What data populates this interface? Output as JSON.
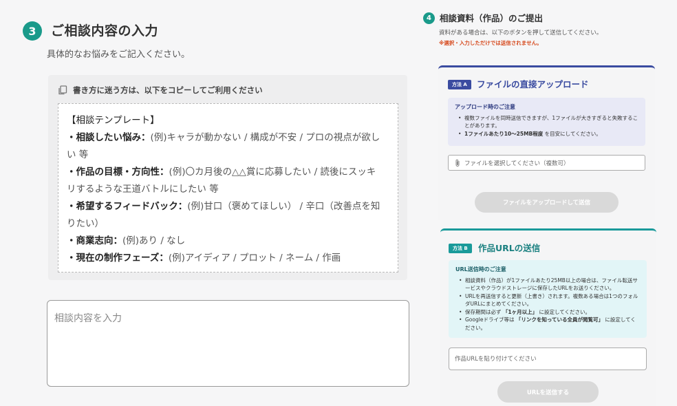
{
  "step3": {
    "number": "3",
    "title": "ご相談内容の入力",
    "description": "具体的なお悩みをご記入ください。",
    "template_header": "書き方に迷う方は、以下をコピーしてご利用ください",
    "template_heading": "【相談テンプレート】",
    "template_items": [
      {
        "label": "・相談したい悩み：",
        "example": "(例)キャラが動かない / 構成が不安 / プロの視点が欲し",
        "cont": "い 等"
      },
      {
        "label": "・作品の目標・方向性：",
        "example": "(例)〇カ月後の△△賞に応募したい / 読後にスッキ",
        "cont": "リするような王道バトルにしたい 等"
      },
      {
        "label": "・希望するフィードバック：",
        "example": "(例)甘口（褒めてほしい） / 辛口（改善点を知",
        "cont": "りたい）"
      },
      {
        "label": "・商業志向：",
        "example": "(例)あり / なし",
        "cont": ""
      },
      {
        "label": "・現在の制作フェーズ：",
        "example": "(例)アイディア / プロット / ネーム / 作画",
        "cont": ""
      }
    ],
    "input_placeholder": "相談内容を入力"
  },
  "step4": {
    "number": "4",
    "title": "相談資料（作品）のご提出",
    "description": "資料がある場合は、以下のボタンを押して送信してください。",
    "warning": "※選択・入力しただけでは送信されません。",
    "method_a": {
      "tag": "方法 A",
      "title": "ファイルの直接アップロード",
      "note_title": "アップロード時のご注意",
      "notes": [
        {
          "text": "複数ファイルを同時送信できますが、1ファイルが大きすぎると失敗することがあります。"
        },
        {
          "bold": "1ファイルあたり10〜25MB程度",
          "text": " を目安にしてください。"
        }
      ],
      "file_placeholder": "ファイルを選択してください（複数可）",
      "button_label": "ファイルをアップロードして送信"
    },
    "method_b": {
      "tag": "方法 B",
      "title": "作品URLの送信",
      "note_title": "URL送信時のご注意",
      "notes": [
        {
          "text": "相談資料（作品）が1ファイルあたり25MB以上の場合は、ファイル転送サービスやクラウドストレージに保存したURLをお送りください。"
        },
        {
          "text": "URLを再送信すると更新（上書き）されます。複数ある場合は1つのフォルダURLにまとめてください。"
        },
        {
          "pre": "保存期間は必ず ",
          "bold": "「1ヶ月以上」",
          "text": " に設定してください。"
        },
        {
          "pre": "Googleドライブ等は ",
          "bold": "「リンクを知っている全員が閲覧可」",
          "text": " に設定してください。"
        }
      ],
      "url_placeholder": "作品URLを貼り付けてください",
      "button_label": "URLを送信する"
    }
  },
  "colors": {
    "teal": "#1a9a8a",
    "navy": "#3a4ba0",
    "warning": "#d64a1e",
    "disabled_button": "#d9d9d9"
  },
  "icons": {
    "copy": "copy-icon",
    "attach": "paperclip-icon"
  }
}
